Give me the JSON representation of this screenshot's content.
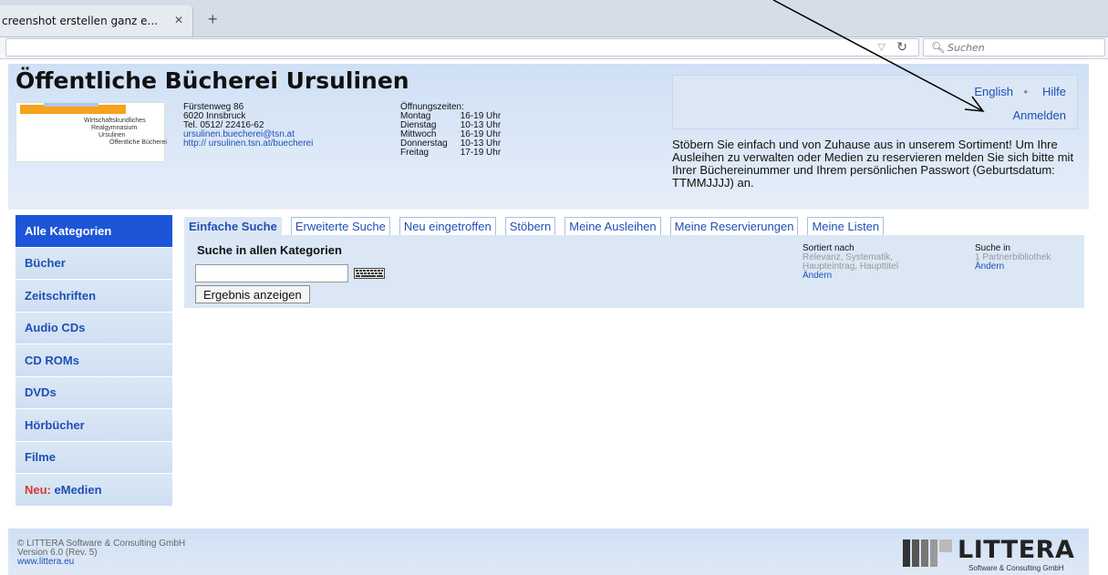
{
  "browser": {
    "tab_title": "creenshot erstellen ganz e...",
    "search_placeholder": "Suchen"
  },
  "header": {
    "title": "Öffentliche Bücherei Ursulinen",
    "logo_lines": [
      "Wirtschaftskundliches",
      "Realgymnasium",
      "Ursulinen",
      "Öffentliche Bücherei"
    ],
    "address": {
      "street": "Fürstenweg 86",
      "city": "6020 Innsbruck",
      "phone": "Tel. 0512/ 22416-62",
      "email": "ursulinen.buecherei@tsn.at",
      "web": "http:// ursulinen.tsn.at/buecherei"
    },
    "hours": {
      "title": "Öffnungszeiten:",
      "rows": [
        {
          "day": "Montag",
          "time": "16-19 Uhr"
        },
        {
          "day": "Dienstag",
          "time": "10-13 Uhr"
        },
        {
          "day": "Mittwoch",
          "time": "16-19 Uhr"
        },
        {
          "day": "Donnerstag",
          "time": "10-13 Uhr"
        },
        {
          "day": "Freitag",
          "time": "17-19 Uhr"
        }
      ]
    },
    "lang_link": "English",
    "separator": "•",
    "help_link": "Hilfe",
    "login_link": "Anmelden",
    "intro": "Stöbern Sie einfach und von Zuhause aus in unserem Sortiment!  Um Ihre Ausleihen zu verwalten oder Medien zu reservieren melden Sie sich bitte mit Ihrer Büchereinummer und Ihrem persönlichen Passwort (Geburtsdatum: TTMMJJJJ) an."
  },
  "sidebar": {
    "items": [
      {
        "label": "Alle Kategorien"
      },
      {
        "label": "Bücher"
      },
      {
        "label": "Zeitschriften"
      },
      {
        "label": "Audio CDs"
      },
      {
        "label": "CD ROMs"
      },
      {
        "label": "DVDs"
      },
      {
        "label": "Hörbücher"
      },
      {
        "label": "Filme"
      }
    ],
    "new_prefix": "Neu:",
    "new_label": "eMedien"
  },
  "tabs": [
    "Einfache Suche",
    "Erweiterte Suche",
    "Neu eingetroffen",
    "Stöbern",
    "Meine Ausleihen",
    "Meine Reservierungen",
    "Meine Listen"
  ],
  "search": {
    "title": "Suche in allen Kategorien",
    "query": "",
    "submit_label": "Ergebnis anzeigen",
    "sort_label": "Sortiert nach",
    "sort_value_1": "Relevanz, Systematik,",
    "sort_value_2": "Haupteintrag, Haupttitel",
    "sort_change": "Ändern",
    "scope_label": "Suche in",
    "scope_value": "1 Partnerbibliothek",
    "scope_change": "Ändern"
  },
  "footer": {
    "copyright": "© LITTERA Software & Consulting GmbH",
    "version": "Version 6.0 (Rev. 5)",
    "link": "www.littera.eu",
    "brand_name": "LITTERA",
    "brand_sub": "Software & Consulting GmbH"
  }
}
